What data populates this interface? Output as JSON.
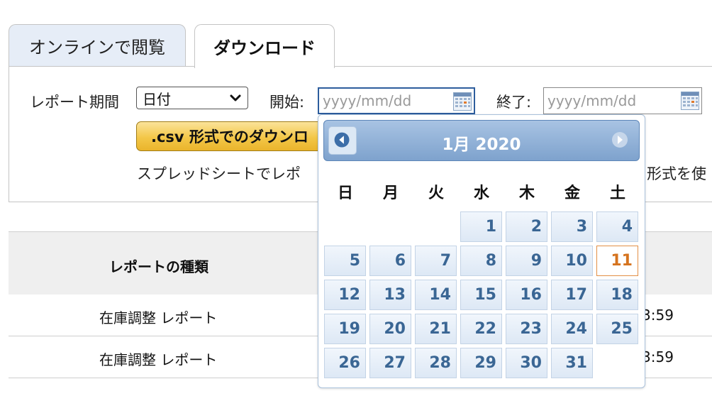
{
  "tabs": [
    {
      "label": "オンラインで閲覧",
      "active": false
    },
    {
      "label": "ダウンロード",
      "active": true
    }
  ],
  "form": {
    "period_label": "レポート期間",
    "period_value": "日付",
    "start_label": "開始:",
    "start_placeholder": "yyyy/mm/dd",
    "end_label": "終了:",
    "end_placeholder": "yyyy/mm/dd",
    "csv_button": ".csv 形式でのダウンロ",
    "note_left": "スプレッドシートでレポ",
    "note_right": "形式を使"
  },
  "table": {
    "header": "レポートの種類",
    "rows": [
      {
        "type": "在庫調整 レポート",
        "time": "3:59"
      },
      {
        "type": "在庫調整 レポート",
        "time": "3:59"
      }
    ]
  },
  "calendar": {
    "title": "1月 2020",
    "weekdays": [
      "日",
      "月",
      "火",
      "水",
      "木",
      "金",
      "土"
    ],
    "first_weekday_index": 3,
    "days_in_month": 31,
    "today": 11,
    "colors": {
      "header": "#7ea2cd",
      "day_text": "#3a6694",
      "today": "#d5731e"
    }
  }
}
